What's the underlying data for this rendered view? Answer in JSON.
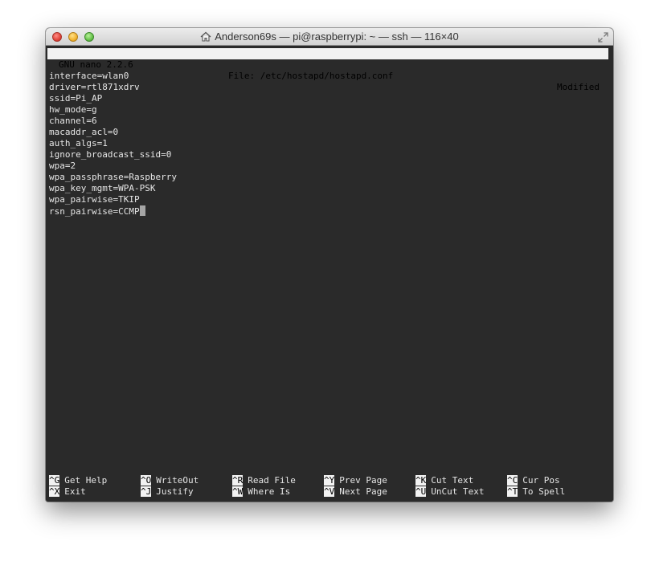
{
  "window": {
    "title": "Anderson69s — pi@raspberrypi: ~ — ssh — 116×40"
  },
  "nano": {
    "version": "GNU nano 2.2.6",
    "file": "File: /etc/hostapd/hostapd.conf",
    "status": "Modified"
  },
  "lines": [
    "interface=wlan0",
    "driver=rtl871xdrv",
    "ssid=Pi_AP",
    "hw_mode=g",
    "channel=6",
    "macaddr_acl=0",
    "auth_algs=1",
    "ignore_broadcast_ssid=0",
    "wpa=2",
    "wpa_passphrase=Raspberry",
    "wpa_key_mgmt=WPA-PSK",
    "wpa_pairwise=TKIP",
    "rsn_pairwise=CCMP"
  ],
  "shortcuts": [
    {
      "key": "^G",
      "label": "Get Help"
    },
    {
      "key": "^O",
      "label": "WriteOut"
    },
    {
      "key": "^R",
      "label": "Read File"
    },
    {
      "key": "^Y",
      "label": "Prev Page"
    },
    {
      "key": "^K",
      "label": "Cut Text"
    },
    {
      "key": "^C",
      "label": "Cur Pos"
    },
    {
      "key": "^X",
      "label": "Exit"
    },
    {
      "key": "^J",
      "label": "Justify"
    },
    {
      "key": "^W",
      "label": "Where Is"
    },
    {
      "key": "^V",
      "label": "Next Page"
    },
    {
      "key": "^U",
      "label": "UnCut Text"
    },
    {
      "key": "^T",
      "label": "To Spell"
    }
  ]
}
